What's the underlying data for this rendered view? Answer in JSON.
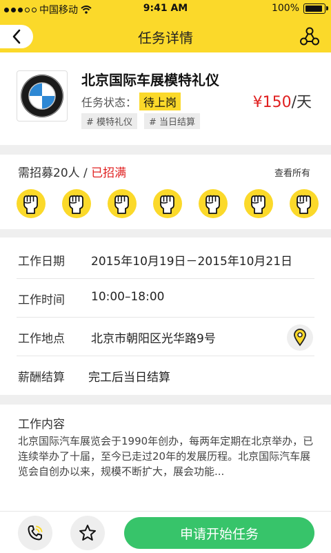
{
  "status_bar": {
    "carrier": "中国移动",
    "time": "9:41 AM",
    "battery": "100%",
    "battery_level": 1.0
  },
  "header": {
    "title": "任务详情",
    "back_icon": "chevron-left-icon",
    "share_icon": "share-icon"
  },
  "task": {
    "title": "北京国际车展模特礼仪",
    "status_label": "任务状态：",
    "status_value": "待上岗",
    "price_amount": "¥150",
    "price_unit": "/天",
    "tags": [
      "# 模特礼仪",
      "# 当日结算"
    ],
    "logo": "bmw-logo"
  },
  "recruit": {
    "count_text": "需招募20人 / ",
    "status_text": "已招满",
    "view_all": "查看所有",
    "avatar_icon": "raised-fist-icon",
    "avatar_count": 7
  },
  "details": {
    "rows": [
      {
        "label": "工作日期",
        "value": "2015年10月19日－2015年10月21日"
      },
      {
        "label": "工作时间",
        "value": "10:00–18:00"
      },
      {
        "label": "工作地点",
        "value": "北京市朝阳区光华路9号"
      },
      {
        "label": "薪酬结算",
        "value": "完工后当日结算"
      }
    ]
  },
  "content": {
    "title": "工作内容",
    "body": "北京国际汽车展览会于1990年创办，每两年定期在北京举办，已连续举办了十届，至今已走过20年的发展历程。北京国际汽车展览会自创办以来，规模不断扩大，展会功能..."
  },
  "bottom": {
    "apply_label": "申请开始任务",
    "phone_icon": "phone-icon",
    "star_icon": "star-icon"
  },
  "colors": {
    "accent": "#fbd92a",
    "price": "#e02020",
    "action": "#37c46a"
  }
}
